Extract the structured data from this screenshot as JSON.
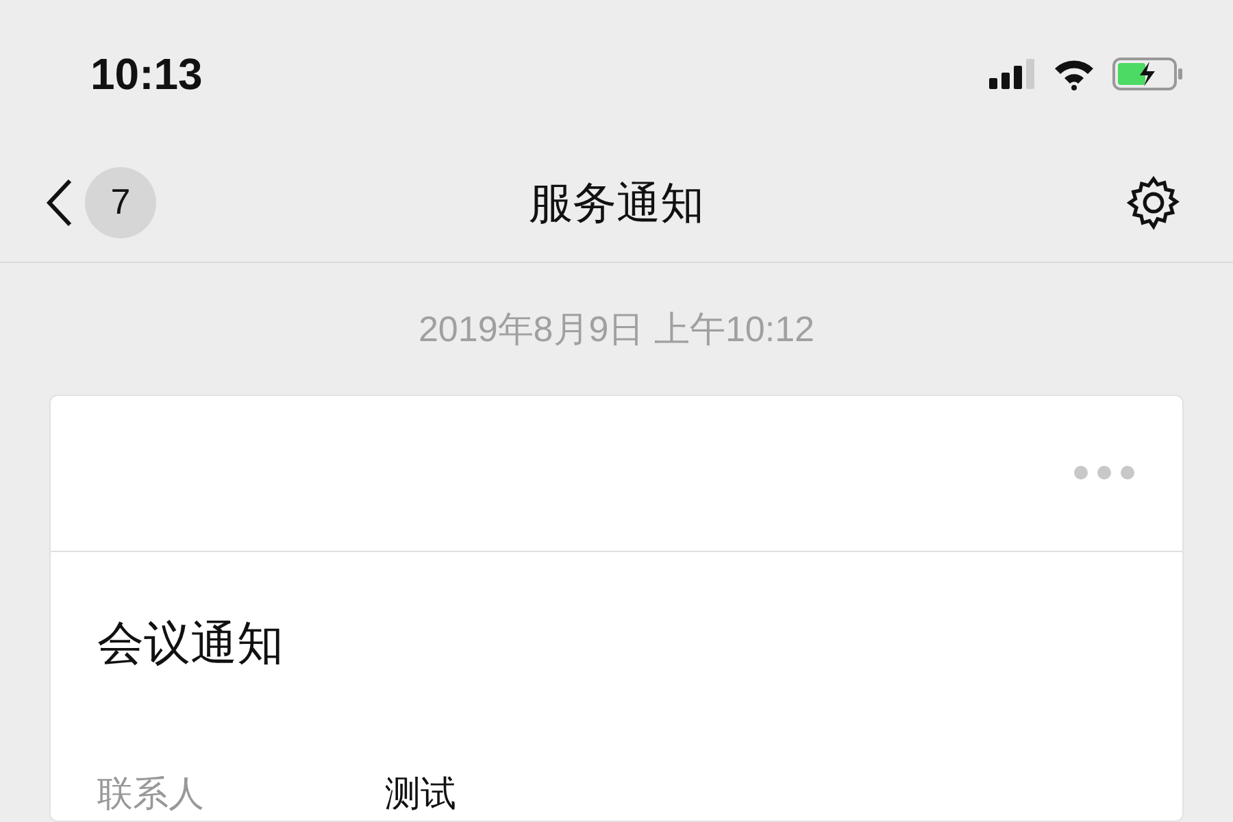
{
  "status_bar": {
    "time": "10:13"
  },
  "nav_bar": {
    "badge": "7",
    "title": "服务通知"
  },
  "date": "2019年8月9日 上午10:12",
  "card": {
    "title": "会议通知",
    "fields": [
      {
        "label": "联系人",
        "value": "测试"
      }
    ]
  }
}
